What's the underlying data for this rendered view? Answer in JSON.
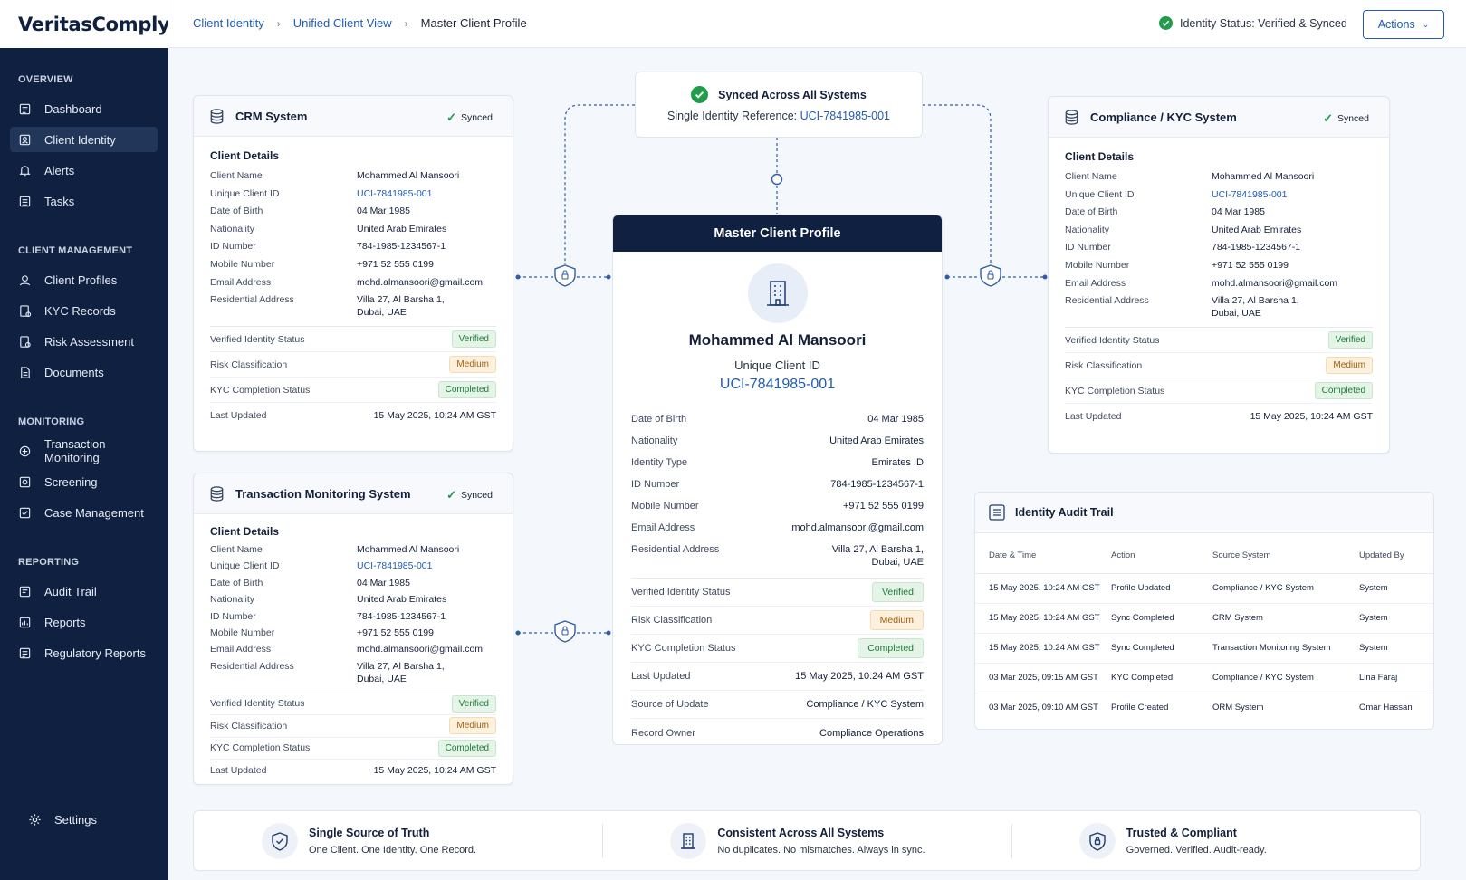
{
  "app": {
    "name": "VeritasComply"
  },
  "sidebar": {
    "sections": [
      {
        "title": "OVERVIEW",
        "items": [
          {
            "label": "Dashboard"
          },
          {
            "label": "Client Identity"
          },
          {
            "label": "Alerts"
          },
          {
            "label": "Tasks"
          }
        ]
      },
      {
        "title": "CLIENT MANAGEMENT",
        "items": [
          {
            "label": "Client Profiles"
          },
          {
            "label": "KYC Records"
          },
          {
            "label": "Risk Assessment"
          },
          {
            "label": "Documents"
          }
        ]
      },
      {
        "title": "MONITORING",
        "items": [
          {
            "label": "Transaction Monitoring"
          },
          {
            "label": "Screening"
          },
          {
            "label": "Case Management"
          }
        ]
      },
      {
        "title": "REPORTING",
        "items": [
          {
            "label": "Audit Trail"
          },
          {
            "label": "Reports"
          },
          {
            "label": "Regulatory Reports"
          }
        ]
      }
    ],
    "active_item": "Client Identity",
    "settings_label": "Settings"
  },
  "header": {
    "breadcrumb": [
      "Client Identity",
      "Unified Client View",
      "Master Client Profile"
    ],
    "identity_status": "Identity Status: Verified & Synced",
    "actions_label": "Actions"
  },
  "sync_banner": {
    "title": "Synced Across All Systems",
    "ref_label": "Single Identity Reference:",
    "ref_value": "UCI-7841985-001"
  },
  "systems": {
    "crm": {
      "title": "CRM System",
      "synced_label": "Synced",
      "section_title": "Client Details",
      "fields": [
        {
          "k": "Client Name",
          "v": "Mohammed Al Mansoori"
        },
        {
          "k": "Unique Client ID",
          "v": "UCI-7841985-001"
        },
        {
          "k": "Date of Birth",
          "v": "04 Mar 1985"
        },
        {
          "k": "Nationality",
          "v": "United Arab Emirates"
        },
        {
          "k": "ID Number",
          "v": "784-1985-1234567-1"
        },
        {
          "k": "Mobile Number",
          "v": "+971 52 555 0199"
        },
        {
          "k": "Email Address",
          "v": "mohd.almansoori@gmail.com"
        },
        {
          "k": "Residential Address",
          "v": "Villa 27, Al Barsha 1,",
          "v2": "Dubai, UAE"
        }
      ],
      "status": [
        {
          "k": "Verified Identity Status",
          "v": "Verified"
        },
        {
          "k": "Risk Classification",
          "v": "Medium"
        },
        {
          "k": "KYC Completion Status",
          "v": "Completed"
        },
        {
          "k": "Last Updated",
          "v": "15 May 2025, 10:24 AM GST"
        }
      ]
    },
    "tms": {
      "title": "Transaction Monitoring System",
      "synced_label": "Synced",
      "section_title": "Client Details",
      "fields": [
        {
          "k": "Client Name",
          "v": "Mohammed Al Mansoori"
        },
        {
          "k": "Unique Client ID",
          "v": "UCI-7841985-001"
        },
        {
          "k": "Date of Birth",
          "v": "04 Mar 1985"
        },
        {
          "k": "Nationality",
          "v": "United Arab Emirates"
        },
        {
          "k": "ID Number",
          "v": "784-1985-1234567-1"
        },
        {
          "k": "Mobile Number",
          "v": "+971 52 555 0199"
        },
        {
          "k": "Email Address",
          "v": "mohd.almansoori@gmail.com"
        },
        {
          "k": "Residential Address",
          "v": "Villa 27, Al Barsha 1,",
          "v2": "Dubai, UAE"
        }
      ],
      "status": [
        {
          "k": "Verified Identity Status",
          "v": "Verified"
        },
        {
          "k": "Risk Classification",
          "v": "Medium"
        },
        {
          "k": "KYC Completion Status",
          "v": "Completed"
        },
        {
          "k": "Last Updated",
          "v": "15 May 2025, 10:24 AM GST"
        }
      ]
    },
    "kyc": {
      "title": "Compliance / KYC System",
      "synced_label": "Synced",
      "section_title": "Client Details",
      "fields": [
        {
          "k": "Client Name",
          "v": "Mohammed Al Mansoori"
        },
        {
          "k": "Unique Client ID",
          "v": "UCI-7841985-001"
        },
        {
          "k": "Date of Birth",
          "v": "04 Mar 1985"
        },
        {
          "k": "Nationality",
          "v": "United Arab Emirates"
        },
        {
          "k": "ID Number",
          "v": "784-1985-1234567-1"
        },
        {
          "k": "Mobile Number",
          "v": "+971 52 555 0199"
        },
        {
          "k": "Email Address",
          "v": "mohd.almansoori@gmail.com"
        },
        {
          "k": "Residential Address",
          "v": "Villa 27, Al Barsha 1,",
          "v2": "Dubai, UAE"
        }
      ],
      "status": [
        {
          "k": "Verified Identity Status",
          "v": "Verified"
        },
        {
          "k": "Risk Classification",
          "v": "Medium"
        },
        {
          "k": "KYC Completion Status",
          "v": "Completed"
        },
        {
          "k": "Last Updated",
          "v": "15 May 2025, 10:24 AM GST"
        }
      ]
    }
  },
  "master": {
    "header": "Master Client Profile",
    "name": "Mohammed Al Mansoori",
    "uci_label": "Unique Client ID",
    "uci": "UCI-7841985-001",
    "fields": [
      {
        "k": "Date of Birth",
        "v": "04 Mar 1985"
      },
      {
        "k": "Nationality",
        "v": "United Arab Emirates"
      },
      {
        "k": "Identity Type",
        "v": "Emirates ID"
      },
      {
        "k": "ID Number",
        "v": "784-1985-1234567-1"
      },
      {
        "k": "Mobile Number",
        "v": "+971 52 555 0199"
      },
      {
        "k": "Email Address",
        "v": "mohd.almansoori@gmail.com"
      },
      {
        "k": "Residential Address",
        "v": "Villa 27, Al Barsha 1,",
        "v2": "Dubai, UAE"
      }
    ],
    "status": [
      {
        "k": "Verified Identity Status",
        "v": "Verified"
      },
      {
        "k": "Risk Classification",
        "v": "Medium"
      },
      {
        "k": "KYC Completion Status",
        "v": "Completed"
      },
      {
        "k": "Last Updated",
        "v": "15 May 2025, 10:24 AM GST"
      },
      {
        "k": "Source of Update",
        "v": "Compliance / KYC System"
      },
      {
        "k": "Record Owner",
        "v": "Compliance Operations"
      }
    ]
  },
  "audit": {
    "title": "Identity Audit Trail",
    "columns": [
      "Date & Time",
      "Action",
      "Source System",
      "Updated By"
    ],
    "rows": [
      [
        "15 May 2025, 10:24 AM GST",
        "Profile Updated",
        "Compliance / KYC System",
        "System"
      ],
      [
        "15 May 2025, 10:24 AM GST",
        "Sync Completed",
        "CRM System",
        "System"
      ],
      [
        "15 May 2025, 10:24 AM GST",
        "Sync Completed",
        "Transaction Monitoring System",
        "System"
      ],
      [
        "03 Mar 2025, 09:15 AM GST",
        "KYC Completed",
        "Compliance / KYC System",
        "Lina Faraj"
      ],
      [
        "03 Mar 2025, 09:10 AM GST",
        "Profile Created",
        "ORM System",
        "Omar Hassan"
      ]
    ]
  },
  "footer": [
    {
      "title": "Single Source of Truth",
      "sub": "One Client. One Identity. One Record.",
      "icon": "shield-check-icon"
    },
    {
      "title": "Consistent Across All Systems",
      "sub": "No duplicates. No mismatches. Always in sync.",
      "icon": "building-icon"
    },
    {
      "title": "Trusted & Compliant",
      "sub": "Governed. Verified. Audit-ready.",
      "icon": "shield-lock-icon"
    }
  ],
  "colors": {
    "navy": "#0f2040",
    "link": "#1f5bb8",
    "green": "#1f9d4b",
    "amber": "#a45f11"
  }
}
